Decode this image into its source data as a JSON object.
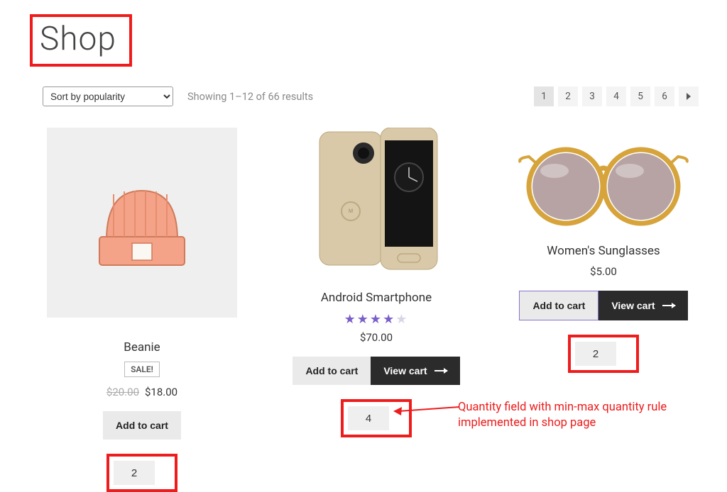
{
  "title": "Shop",
  "sort_select": "Sort by popularity",
  "result_count": "Showing 1–12 of 66 results",
  "pagination": {
    "pages": [
      "1",
      "2",
      "3",
      "4",
      "5",
      "6"
    ],
    "current": "1"
  },
  "products": [
    {
      "name": "Beanie",
      "sale": "SALE!",
      "strike": "$20.00",
      "price": "$18.00",
      "add": "Add to cart",
      "qty": "2"
    },
    {
      "name": "Android Smartphone",
      "rating_full": "★★★★",
      "rating_empty": "★",
      "price": "$70.00",
      "add": "Add to cart",
      "view": "View cart",
      "qty": "4"
    },
    {
      "name": "Women's Sunglasses",
      "price": "$5.00",
      "add": "Add to cart",
      "view": "View cart",
      "qty": "2"
    }
  ],
  "annotation": {
    "line1": "Quantity field with min-max quantity rule",
    "line2": "implemented in shop page"
  }
}
